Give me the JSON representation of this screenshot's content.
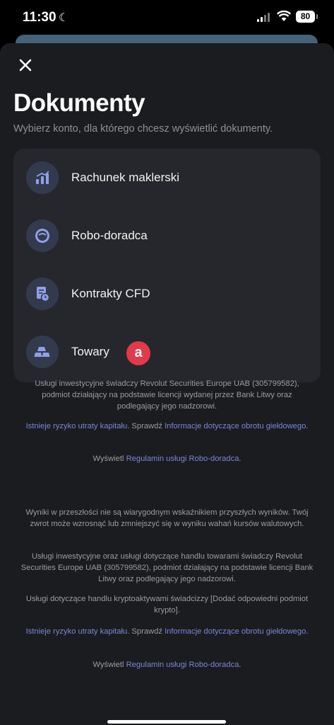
{
  "status": {
    "time": "11:30",
    "battery": "80"
  },
  "header": {
    "title": "Dokumenty",
    "subtitle": "Wybierz konto, dla którego chcesz wyświetlić dokumenty."
  },
  "accounts": [
    {
      "label": "Rachunek maklerski",
      "icon": "bar-chart-icon"
    },
    {
      "label": "Robo-doradca",
      "icon": "robo-advisor-icon"
    },
    {
      "label": "Kontrakty CFD",
      "icon": "document-clock-icon"
    },
    {
      "label": "Towary",
      "icon": "gold-bars-icon"
    }
  ],
  "annotation_badge": "a",
  "disclaimers": {
    "p1": "Usługi inwestycyjne świadczy Revolut Securities Europe UAB (305799582), podmiot działający na podstawie licencji wydanej przez Bank Litwy oraz podlegający jego nadzorowi.",
    "risk1_link": "Istnieje ryzyko utraty kapitału.",
    "risk1_mid": " Sprawdź ",
    "risk1_info": "Informacje dotyczące obrotu giełdowego",
    "risk1_end": ".",
    "view1_prefix": "Wyświetl ",
    "view1_link": "Regulamin usługi Robo-doradca",
    "view1_end": ".",
    "p2": "Wyniki w przeszłości nie są wiarygodnym wskaźnikiem przyszłych wyników. Twój zwrot może wzrosnąć lub zmniejszyć się w wyniku wahań kursów walutowych.",
    "p3": "Usługi inwestycyjne oraz usługi dotyczące handlu towarami świadczy Revolut Securities Europe UAB (305799582), podmiot działający na podstawie licencji Bank Litwy oraz podlegający jego nadzorowi.",
    "p4": "Usługi dotyczące handlu kryptoaktywami świadcizzy [Dodać odpowiedni podmiot krypto].",
    "risk2_link": "Istnieje ryzyko utraty kapitału.",
    "risk2_mid": " Sprawdź ",
    "risk2_info": "Informacje dotyczące obrotu giełdowego",
    "risk2_end": ".",
    "view2_prefix": "Wyświetl ",
    "view2_link": "Regulamin usługi Robo-doradca",
    "view2_end": "."
  },
  "colors": {
    "accent": "#7a86d8",
    "badge": "#e23a4a",
    "icon_bg": "#343a4e"
  }
}
